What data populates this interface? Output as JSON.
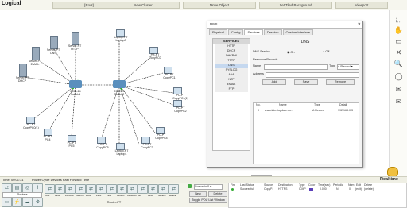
{
  "topbar": {
    "logical": "Logical",
    "root": "[Root]",
    "new_cluster": "New Cluster",
    "move_object": "Move Object",
    "set_tiled_bg": "Set Tiled Background",
    "viewport": "Viewport"
  },
  "nodes": {
    "server_pt_http": "Server-PT\nHTTP",
    "server_pt_dns": "Server-PT\nDNS",
    "server_pt_dhcp": "Server-PT\nDHCP",
    "server_pt_a": "Server-PT\nEMAIL",
    "server_pt_b": "Server-PT\nFTP",
    "switch_1": "2950-24\nSwitch1",
    "switch_2": "2950-24\nSwitch2",
    "laptop_1": "Laptop-PT\nLaptop0",
    "pc_1": "PC-PT\nCopyPC0(1)",
    "pc_2": "PC-PT\nCopyPC1(1)",
    "pc_3": "PC-PT\nCopyPC1",
    "pc_4": "PC-PT\nCopyPC2",
    "pc_5": "PC-PT\nCopyPC3",
    "pc_6": "PC-PT\nCopyPC4",
    "pc_7": "PC-PT\nPC4",
    "pc_8": "PC-PT\nPC5",
    "pc_9": "PC-PT\nCopyPC0",
    "laptop_2": "Laptop-PT\nLaptop1",
    "pc_10": "PC-PT\nCopyPC5"
  },
  "dialog": {
    "title": "DNS",
    "tabs": [
      "Physical",
      "Config",
      "Services",
      "Desktop",
      "Custom Interface"
    ],
    "services_header": "SERVICES",
    "services": [
      "HTTP",
      "DHCP",
      "DHCPv6",
      "TFTP",
      "DNS",
      "SYSLOG",
      "AAA",
      "NTP",
      "EMAIL",
      "FTP"
    ],
    "selected_service": "DNS",
    "dns_heading": "DNS",
    "dns_service_label": "DNS Service",
    "on_label": "On",
    "off_label": "Off",
    "resource_records": "Resource Records",
    "name_label": "Name",
    "type_label": "Type",
    "type_value": "A Record",
    "address_label": "Address",
    "add": "Add",
    "save": "Save",
    "remove": "Remove",
    "columns": [
      "No.",
      "Name",
      "Type",
      "Detail"
    ],
    "record": {
      "no": "0",
      "name": "www.latestupdate.co...",
      "type": "A Record",
      "detail": "192.168.0.3"
    },
    "dns_cache": "DNS Cache"
  },
  "status": {
    "time": "Time: 00:01:31",
    "power": "Power Cycle Devices  Fast Forward Time",
    "realtime": "Realtime"
  },
  "bottom": {
    "category": "Routers",
    "device_models": [
      "1841",
      "1941",
      "2620XM",
      "2621XM",
      "2811",
      "2901",
      "2911",
      "819IOX",
      "819HGW",
      "829",
      "1240",
      "Generic",
      "Generic"
    ],
    "device_name": "Router-PT",
    "scenario": "Scenario 0",
    "new": "New",
    "delete": "Delete",
    "toggle_pdu": "Toggle PDU List Window",
    "pdu_columns": [
      "Fire",
      "Last Status",
      "Source",
      "Destination",
      "Type",
      "Color",
      "Time(sec)",
      "Periodic",
      "Num",
      "Edit",
      "Delete"
    ],
    "pdu_row": {
      "status": "Successful",
      "source": "CopyP..",
      "destination": "HTTPS",
      "type": "ICMP",
      "time": "0.000",
      "periodic": "N",
      "num": "0",
      "edit": "(edit)",
      "delete": "(delete)"
    }
  }
}
